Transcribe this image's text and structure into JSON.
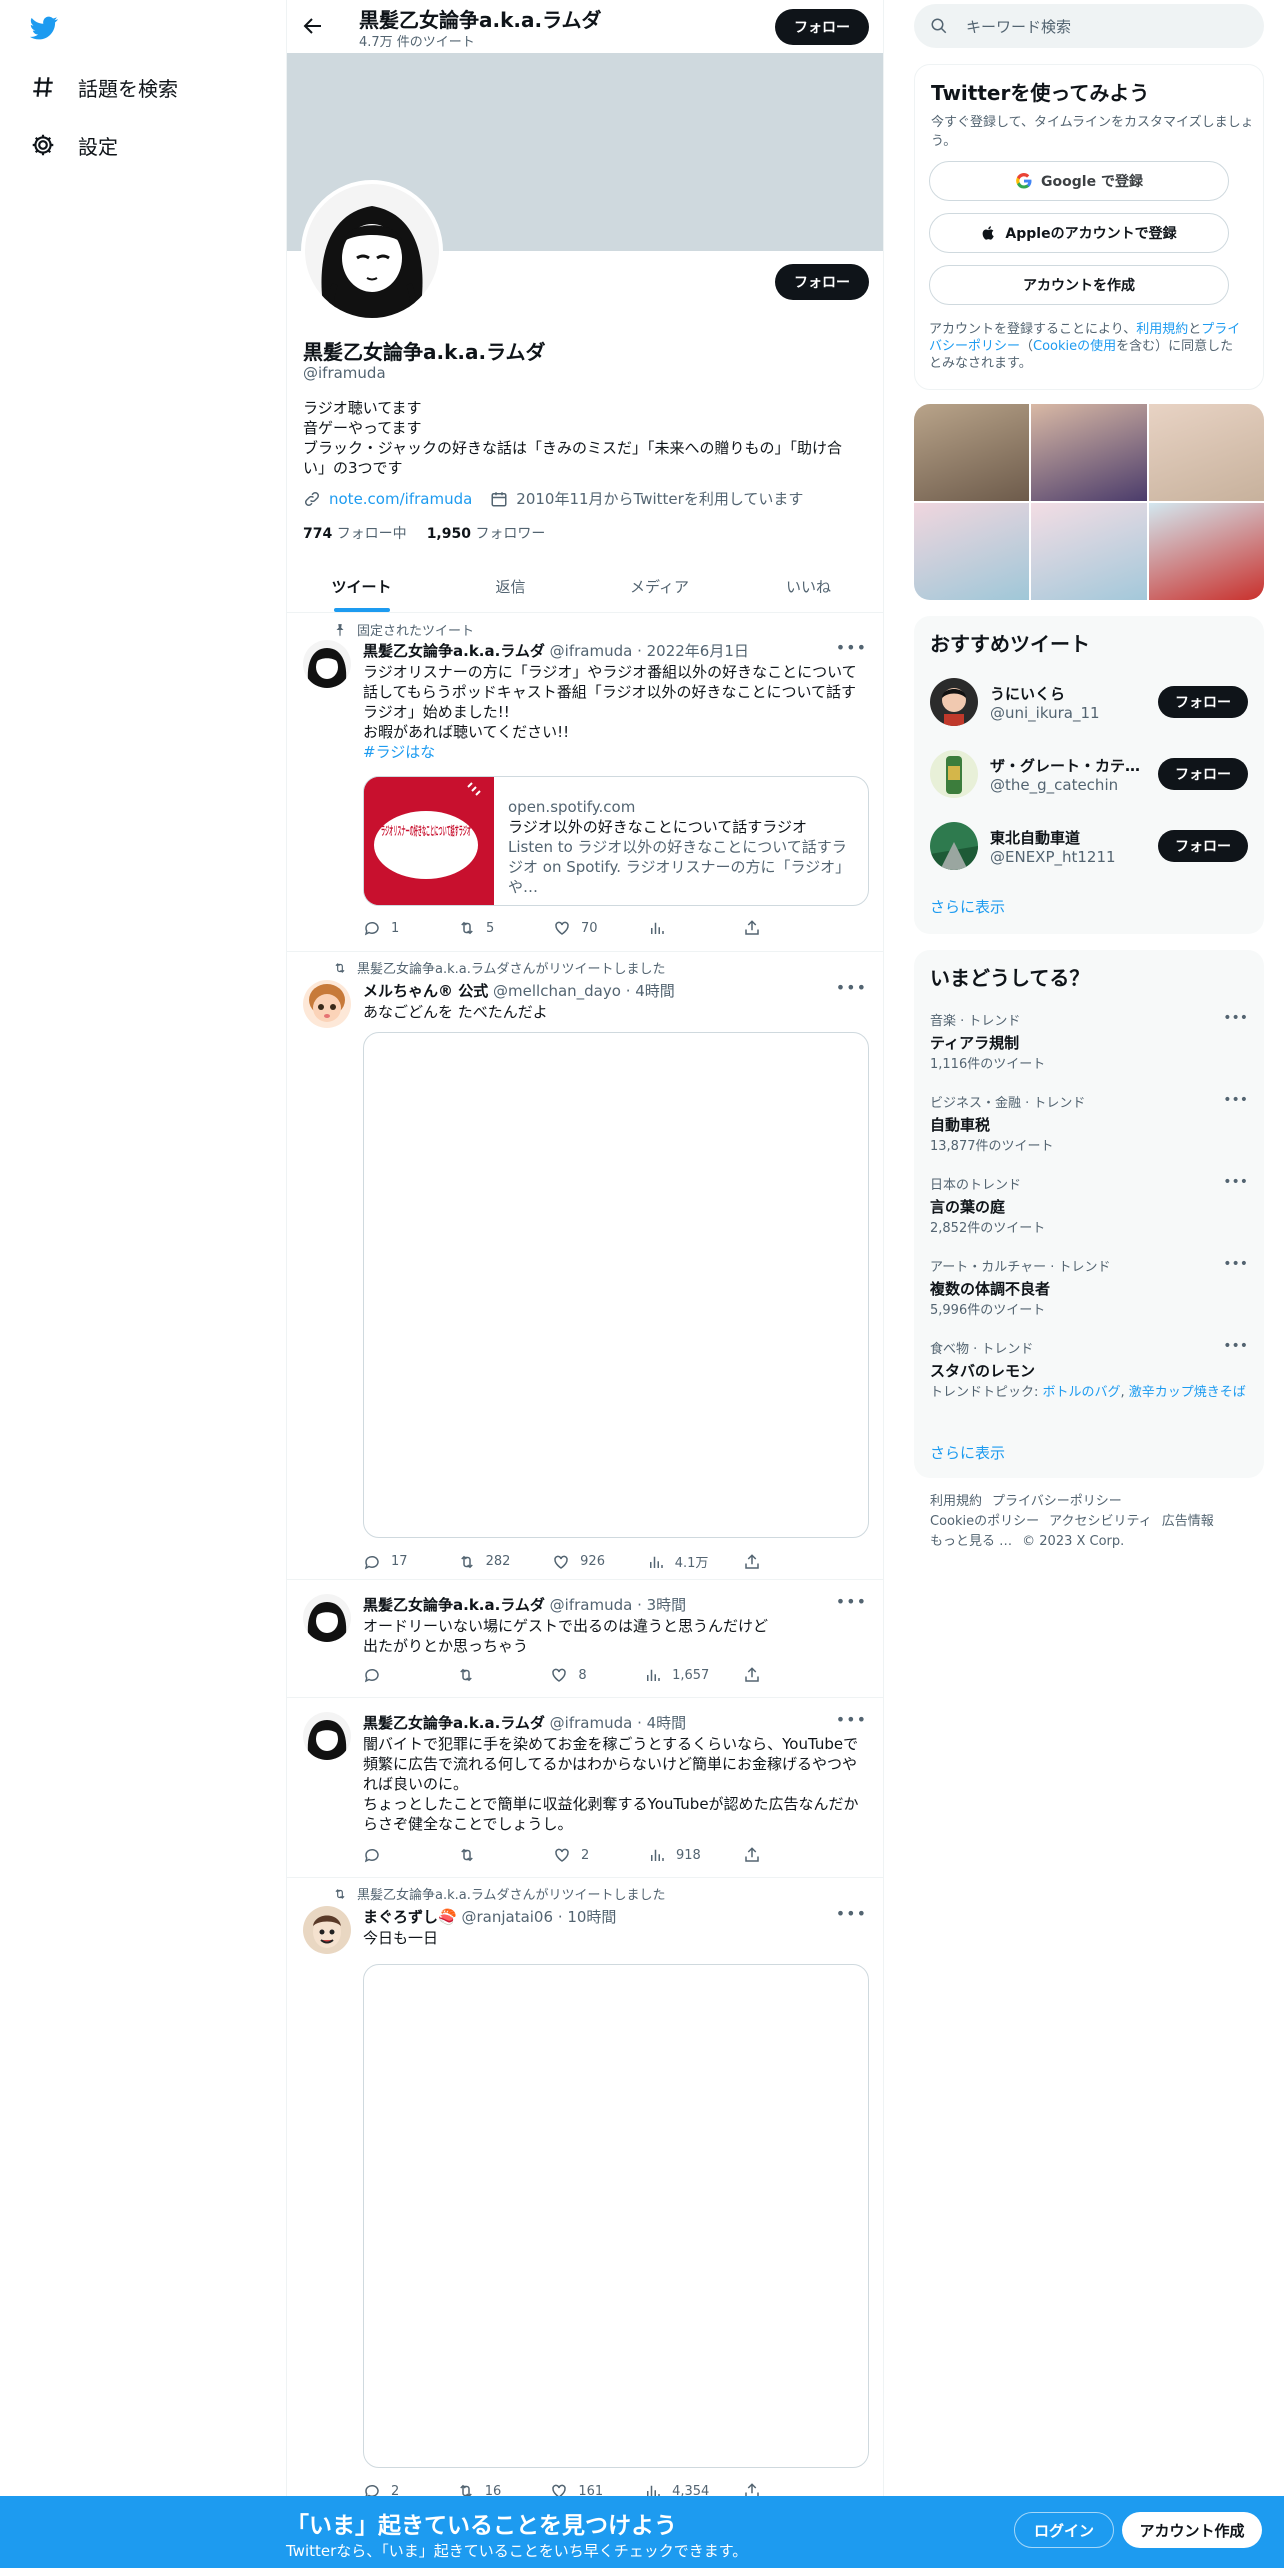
{
  "nav": {
    "explore": "話題を検索",
    "settings": "設定"
  },
  "profile": {
    "top_name": "黒髪乙女論争a.k.a.ラムダ",
    "tweet_count": "4.7万 件のツイート",
    "follow_label": "フォロー",
    "name": "黒髪乙女論争a.k.a.ラムダ",
    "handle": "@iframuda",
    "bio_lines": [
      "ラジオ聴いてます",
      "音ゲーやってます",
      "ブラック・ジャックの好きな話は「きみのミスだ」「未来への贈りもの」「助け合",
      "い」の3つです"
    ],
    "link": "note.com/iframuda",
    "joined": "2010年11月からTwitterを利用しています",
    "following_count": "774",
    "following_label": "フォロー中",
    "followers_count": "1,950",
    "followers_label": "フォロワー"
  },
  "tabs": [
    "ツイート",
    "返信",
    "メディア",
    "いいね"
  ],
  "tweets": [
    {
      "social": "固定されたツイート",
      "name": "黒髪乙女論争a.k.a.ラムダ",
      "handle": "@iframuda",
      "time": "· 2022年6月1日",
      "lines": [
        "ラジオリスナーの方に「ラジオ」やラジオ番組以外の好きなことについて",
        "話してもらうポッドキャスト番組「ラジオ以外の好きなことについて話す",
        "ラジオ」始めました!!",
        "お暇があれば聴いてください!!"
      ],
      "hashtag": "#ラジはな",
      "card": {
        "domain": "open.spotify.com",
        "title": "ラジオ以外の好きなことについて話すラジオ",
        "desc": "Listen to ラジオ以外の好きなことについて話すラジオ on Spotify. ラジオリスナーの方に「ラジオ」や…",
        "image_text": "ラジオリスナーの好きなことについて話すラジオ"
      },
      "replies": "1",
      "retweets": "5",
      "likes": "70",
      "views": ""
    },
    {
      "social": "黒髪乙女論争a.k.a.ラムダさんがリツイートしました",
      "name": "メルちゃん® 公式",
      "handle": "@mellchan_dayo",
      "time": "· 4時間",
      "lines": [
        "あなごどんを たべたんだよ"
      ],
      "replies": "17",
      "retweets": "282",
      "likes": "926",
      "views": "4.1万"
    },
    {
      "name": "黒髪乙女論争a.k.a.ラムダ",
      "handle": "@iframuda",
      "time": "· 3時間",
      "lines": [
        "オードリーいない場にゲストで出るのは違うと思うんだけど",
        "出たがりとか思っちゃう"
      ],
      "replies": "",
      "retweets": "",
      "likes": "8",
      "views": "1,657"
    },
    {
      "name": "黒髪乙女論争a.k.a.ラムダ",
      "handle": "@iframuda",
      "time": "· 4時間",
      "lines": [
        "闇バイトで犯罪に手を染めてお金を稼ごうとするくらいなら、YouTubeで",
        "頻繁に広告で流れる何してるかはわからないけど簡単にお金稼げるやつや",
        "れば良いのに。",
        "ちょっとしたことで簡単に収益化剥奪するYouTubeが認めた広告なんだか",
        "らさぞ健全なことでしょうし。"
      ],
      "replies": "",
      "retweets": "",
      "likes": "2",
      "views": "918"
    },
    {
      "social": "黒髪乙女論争a.k.a.ラムダさんがリツイートしました",
      "name": "まぐろずし🍣",
      "handle": "@ranjatai06",
      "time": "· 10時間",
      "lines": [
        "今日も一日"
      ],
      "replies": "2",
      "retweets": "16",
      "likes": "161",
      "views": "4,354"
    }
  ],
  "search": {
    "placeholder": "キーワード検索"
  },
  "signup": {
    "title": "Twitterを使ってみよう",
    "sub": "今すぐ登録して、タイムラインをカスタマイズしましょう。",
    "google": "Google で登録",
    "apple": "Appleのアカウントで登録",
    "create": "アカウントを作成",
    "legal_pre": "アカウントを登録することにより、",
    "legal_terms": "利用規約",
    "legal_and": "と",
    "legal_privacy": "プライバシーポリシー",
    "legal_paren_open": "（",
    "legal_cookie": "Cookieの使用",
    "legal_post": "を含む）に同意したとみなされます。"
  },
  "recommend": {
    "title": "おすすめツイート",
    "users": [
      {
        "name": "うにいくら",
        "handle": "@uni_ikura_11"
      },
      {
        "name": "ザ・グレート・カテ…",
        "handle": "@the_g_catechin"
      },
      {
        "name": "東北自動車道",
        "handle": "@ENEXP_ht1211"
      }
    ],
    "follow_label": "フォロー",
    "more": "さらに表示"
  },
  "trends": {
    "title": "いまどうしてる？",
    "items": [
      {
        "cat": "音楽 · トレンド",
        "name": "ティアラ規制",
        "count": "1,116件のツイート"
      },
      {
        "cat": "ビジネス・金融 · トレンド",
        "name": "自動車税",
        "count": "13,877件のツイート"
      },
      {
        "cat": "日本のトレンド",
        "name": "言の葉の庭",
        "count": "2,852件のツイート"
      },
      {
        "cat": "アート・カルチャー · トレンド",
        "name": "複数の体調不良者",
        "count": "5,996件のツイート"
      },
      {
        "cat": "食べ物 · トレンド",
        "name": "スタバのレモン",
        "count_prefix": "トレンドトピック: ",
        "topic1": "ボトルのバグ",
        "sep": ", ",
        "topic2": "激辛カップ焼きそば"
      }
    ],
    "more": "さらに表示"
  },
  "footer": {
    "terms": "利用規約",
    "privacy": "プライバシーポリシー",
    "cookie": "Cookieのポリシー",
    "access": "アクセシビリティ",
    "ads": "広告情報",
    "more": "もっと見る …",
    "copyright": "© 2023 X Corp."
  },
  "bottom": {
    "title": "「いま」起きていることを見つけよう",
    "sub": "Twitterなら、「いま」起きていることをいち早くチェックできます。",
    "login": "ログイン",
    "signup": "アカウント作成"
  },
  "colors": {
    "accent": "#1d9bf0",
    "dark": "#0f1419",
    "muted": "#536471"
  }
}
